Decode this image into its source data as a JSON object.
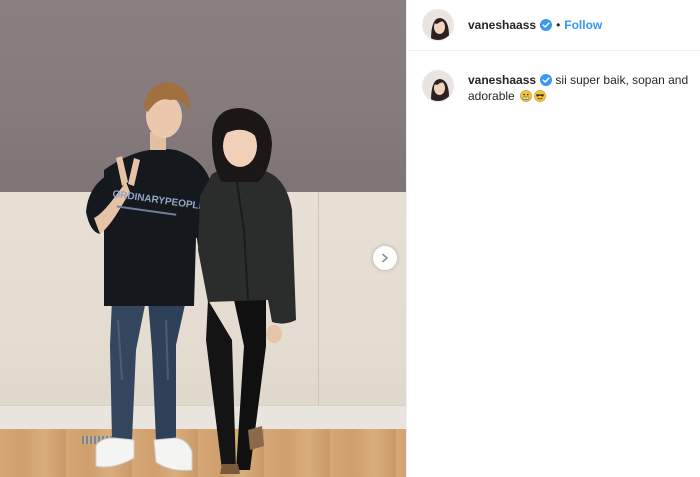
{
  "post": {
    "username": "vaneshaass",
    "separator": "•",
    "follow_label": "Follow",
    "caption": {
      "username": "vaneshaass",
      "text": "sii super baik, sopan and adorable"
    },
    "emojis": [
      "grimacing-face",
      "smiling-face-with-sunglasses"
    ]
  },
  "colors": {
    "link_blue": "#3897f0",
    "verified_blue": "#3897f0",
    "text": "#262626",
    "divider": "#efefef"
  },
  "icons": {
    "verified": "verified-badge-icon",
    "carousel": "chevron-right-icon"
  }
}
